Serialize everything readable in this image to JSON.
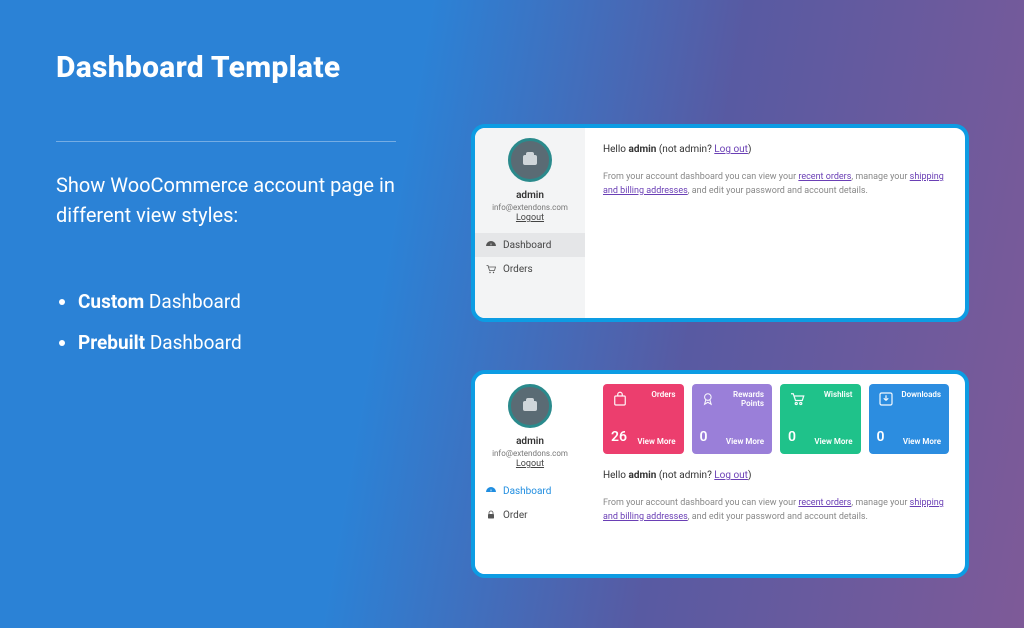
{
  "page": {
    "title": "Dashboard Template",
    "subtitle": "Show WooCommerce account page in different view styles:",
    "bullets": [
      {
        "bold": "Custom",
        "rest": " Dashboard"
      },
      {
        "bold": "Prebuilt",
        "rest": " Dashboard"
      }
    ]
  },
  "user": {
    "name": "admin",
    "email": "info@extendons.com",
    "logout_label": "Logout"
  },
  "nav": {
    "dashboard": "Dashboard",
    "orders": "Orders",
    "order": "Order"
  },
  "greeting": {
    "pre": "Hello ",
    "user": "admin",
    "mid": " (not admin? ",
    "link": "Log out",
    "post": ")"
  },
  "description": {
    "t1": "From your account dashboard you can view your ",
    "l1": "recent orders",
    "t2": ", manage your ",
    "l2": "shipping and billing addresses",
    "t3": ", and edit your password and account details."
  },
  "cards": [
    {
      "label": "Orders",
      "value": "26",
      "view": "View More",
      "color": "#ec3e6e"
    },
    {
      "label": "Rewards Points",
      "value": "0",
      "view": "View More",
      "color": "#9a7fd9"
    },
    {
      "label": "Wishlist",
      "value": "0",
      "view": "View More",
      "color": "#1fc28a"
    },
    {
      "label": "Downloads",
      "value": "0",
      "view": "View More",
      "color": "#2c8de0"
    }
  ]
}
